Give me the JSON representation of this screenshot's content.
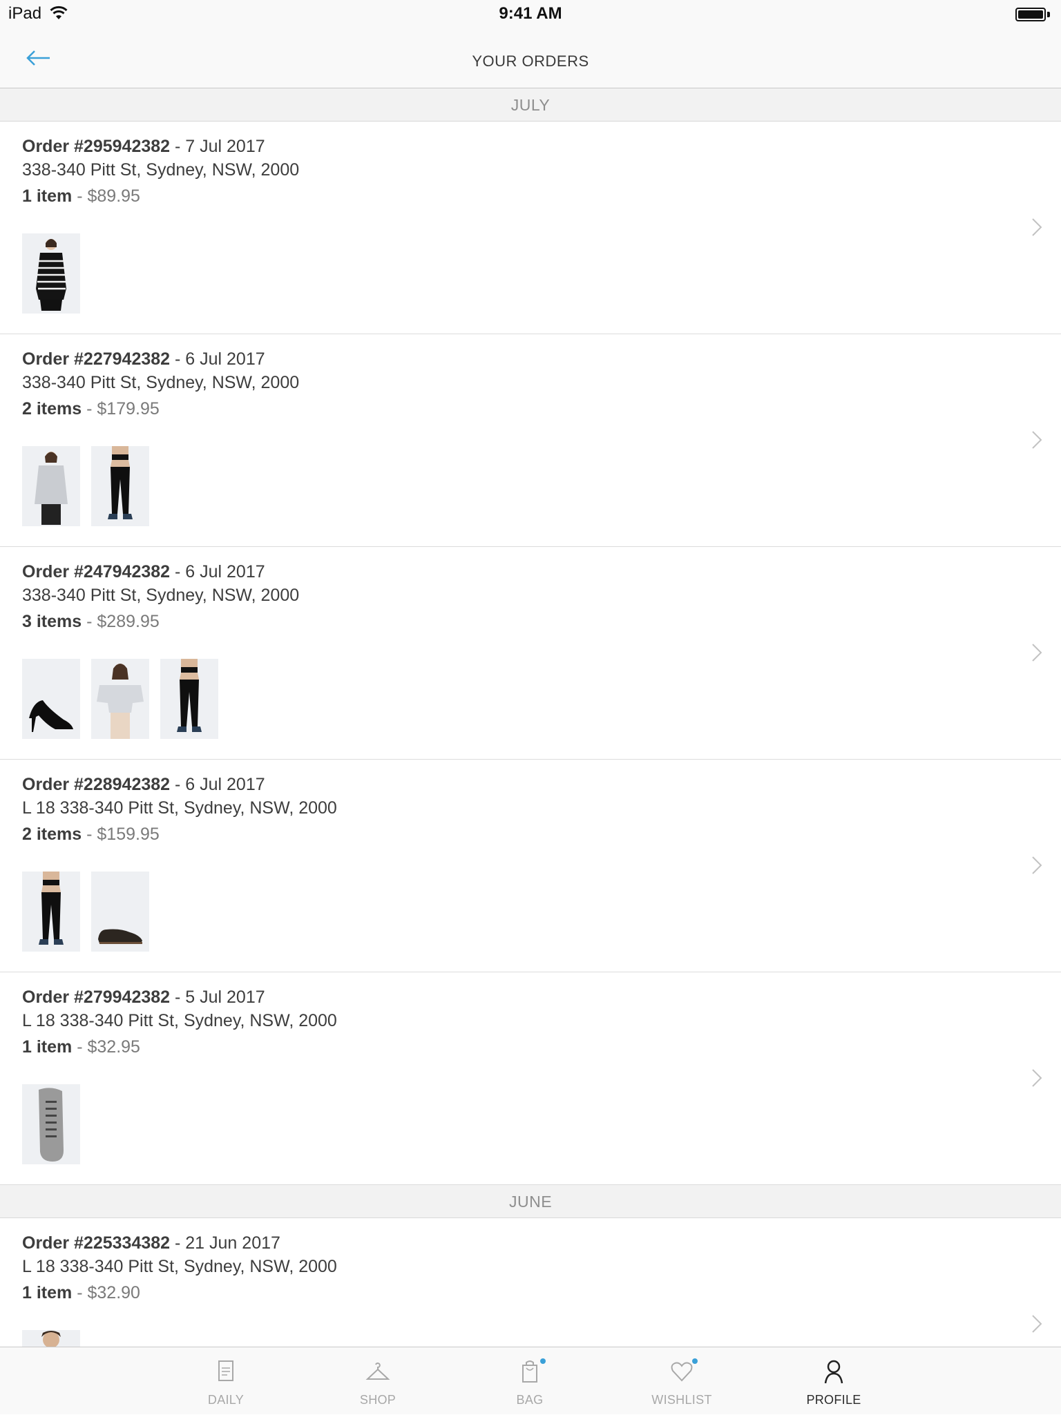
{
  "status_bar": {
    "device": "iPad",
    "time": "9:41 AM"
  },
  "nav": {
    "title": "YOUR ORDERS",
    "back_icon": "arrow-left-icon"
  },
  "colors": {
    "accent": "#3aa0d8",
    "section_bg": "#f2f2f2",
    "divider": "#dcdcdc"
  },
  "sections": [
    {
      "title": "JULY",
      "orders": [
        {
          "number": "Order #295942382",
          "date": " - 7 Jul 2017",
          "address": "338-340 Pitt St, Sydney, NSW, 2000",
          "count": "1 item",
          "price": " - $89.95",
          "thumbs": [
            "striped-sweater"
          ]
        },
        {
          "number": "Order #227942382",
          "date": " - 6 Jul 2017",
          "address": "338-340 Pitt St, Sydney, NSW, 2000",
          "count": "2 items",
          "price": " - $179.95",
          "thumbs": [
            "grey-top",
            "black-leggings"
          ]
        },
        {
          "number": "Order #247942382",
          "date": " - 6 Jul 2017",
          "address": "338-340 Pitt St, Sydney, NSW, 2000",
          "count": "3 items",
          "price": " - $289.95",
          "thumbs": [
            "black-heels",
            "off-shoulder-top",
            "black-leggings"
          ]
        },
        {
          "number": "Order #228942382",
          "date": " - 6 Jul 2017",
          "address": "L 18 338-340 Pitt St, Sydney, NSW, 2000",
          "count": "2 items",
          "price": " - $159.95",
          "thumbs": [
            "black-leggings",
            "brown-shoe"
          ]
        },
        {
          "number": "Order #279942382",
          "date": " - 5 Jul 2017",
          "address": "L 18 338-340 Pitt St, Sydney, NSW, 2000",
          "count": "1 item",
          "price": " - $32.95",
          "thumbs": [
            "grey-sock"
          ]
        }
      ]
    },
    {
      "title": "JUNE",
      "orders": [
        {
          "number": "Order #225334382",
          "date": " - 21 Jun 2017",
          "address": "L 18 338-340 Pitt St, Sydney, NSW, 2000",
          "count": "1 item",
          "price": " - $32.90",
          "thumbs": [
            "man-portrait"
          ]
        }
      ]
    }
  ],
  "tabs": [
    {
      "label": "DAILY",
      "icon": "newspaper-icon",
      "active": false,
      "badge": false
    },
    {
      "label": "SHOP",
      "icon": "hanger-icon",
      "active": false,
      "badge": false
    },
    {
      "label": "BAG",
      "icon": "bag-icon",
      "active": false,
      "badge": true
    },
    {
      "label": "WISHLIST",
      "icon": "heart-icon",
      "active": false,
      "badge": true
    },
    {
      "label": "PROFILE",
      "icon": "profile-icon",
      "active": true,
      "badge": false
    }
  ]
}
